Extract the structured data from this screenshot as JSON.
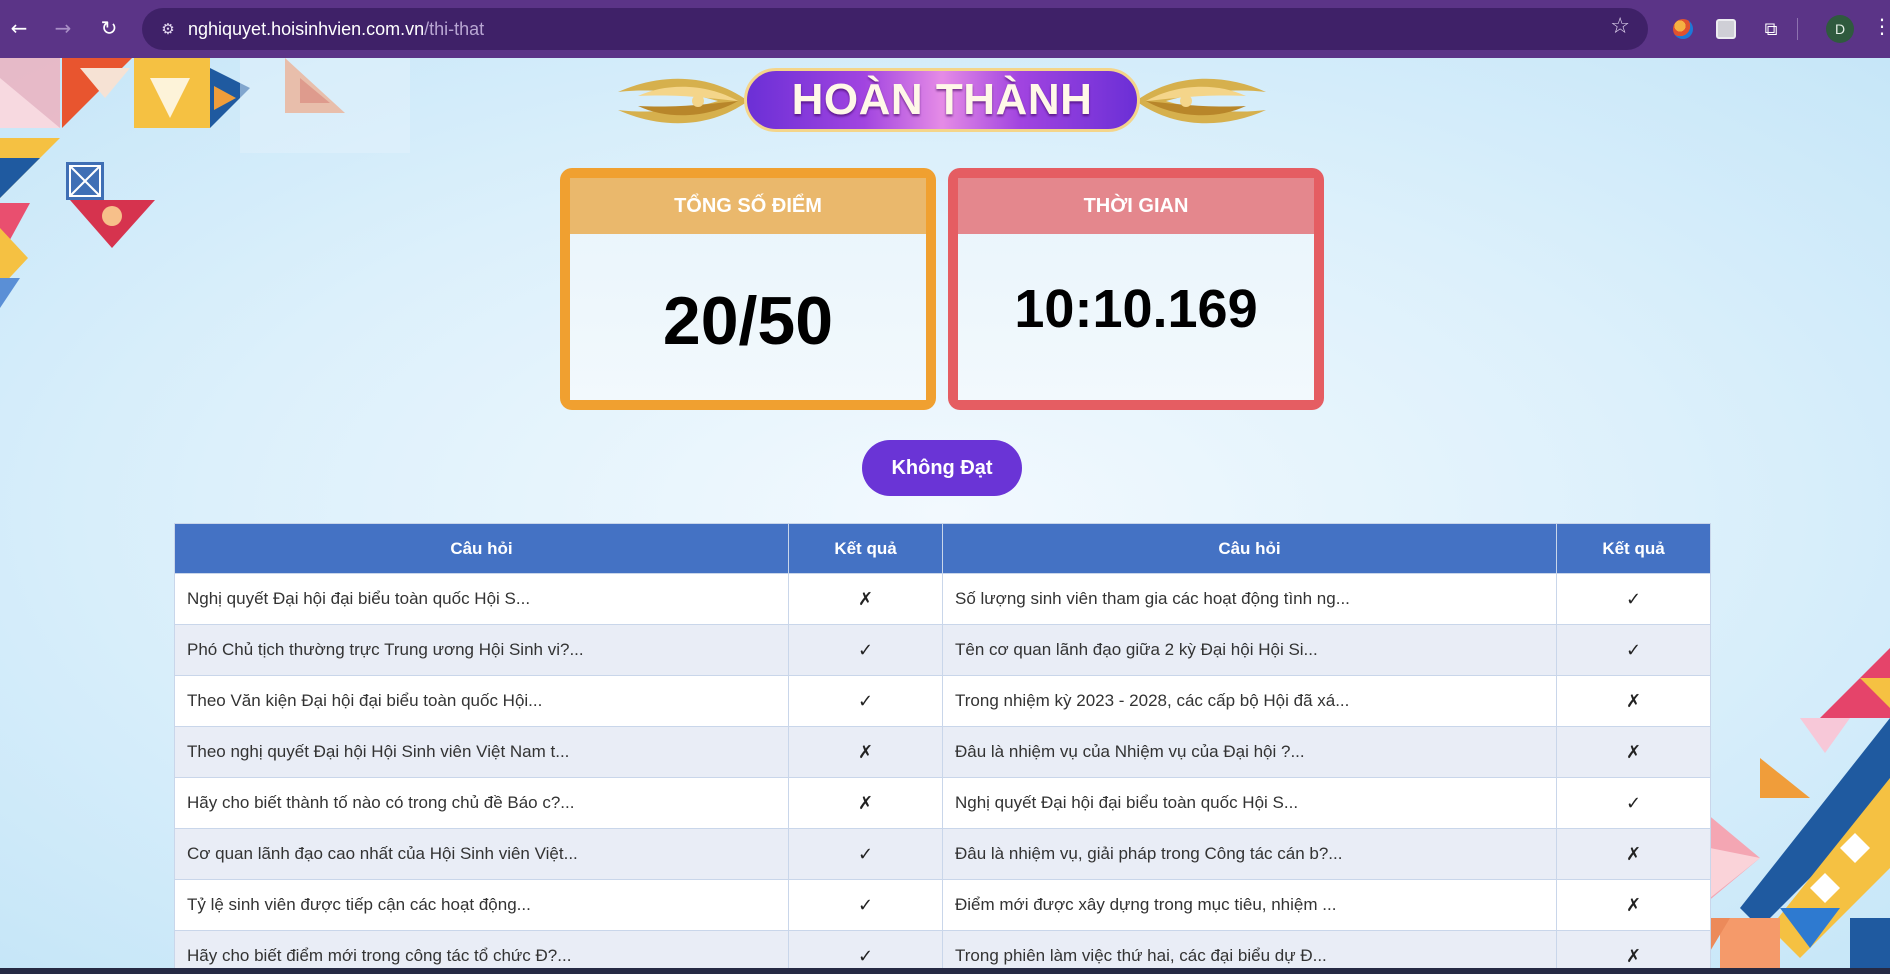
{
  "browser": {
    "url_host": "nghiquyet.hoisinhvien.com.vn",
    "url_path": "/thi-that",
    "profile_initial": "D",
    "icons": [
      "back-icon",
      "forward-icon",
      "reload-icon",
      "site-info-icon",
      "bookmark-star-icon",
      "firefox-extension-icon",
      "extension-icon",
      "puzzle-extensions-icon",
      "menu-icon"
    ]
  },
  "banner": {
    "title": "HOÀN THÀNH"
  },
  "score_card": {
    "label": "TỔNG SỐ ĐIỂM",
    "value": "20/50"
  },
  "time_card": {
    "label": "THỜI GIAN",
    "value": "10:10.169"
  },
  "status": {
    "label": "Không Đạt"
  },
  "colors": {
    "chrome": "#5b3487",
    "score_card": "#f0a030",
    "time_card": "#e55d62",
    "status_button": "#6a34d6",
    "table_header": "#4472c4"
  },
  "table": {
    "headers": [
      "Câu hỏi",
      "Kết quả",
      "Câu hỏi",
      "Kết quả"
    ],
    "rows": [
      {
        "q1": "Nghị quyết Đại hội đại biểu toàn quốc Hội S...",
        "r1": "✗",
        "q2": "Số lượng sinh viên tham gia các hoạt động tình ng...",
        "r2": "✓"
      },
      {
        "q1": "Phó Chủ tịch thường trực Trung ương Hội Sinh vi?...",
        "r1": "✓",
        "q2": "Tên cơ quan lãnh đạo giữa 2 kỳ Đại hội Hội Si...",
        "r2": "✓"
      },
      {
        "q1": "Theo Văn kiện Đại hội đại biểu toàn quốc Hội...",
        "r1": "✓",
        "q2": "Trong nhiệm kỳ 2023 - 2028, các cấp bộ Hội đã xá...",
        "r2": "✗"
      },
      {
        "q1": "Theo nghị quyết Đại hội Hội Sinh viên Việt Nam t...",
        "r1": "✗",
        "q2": "Đâu là nhiệm vụ của Nhiệm vụ của Đại hội ?...",
        "r2": "✗"
      },
      {
        "q1": "Hãy cho biết thành tố nào có trong chủ đề Báo c?...",
        "r1": "✗",
        "q2": "Nghị quyết Đại hội đại biểu toàn quốc Hội S...",
        "r2": "✓"
      },
      {
        "q1": "Cơ quan lãnh đạo cao nhất của Hội Sinh viên Việt...",
        "r1": "✓",
        "q2": "Đâu là nhiệm vụ, giải pháp trong Công tác cán b?...",
        "r2": "✗"
      },
      {
        "q1": "Tỷ lệ sinh viên được tiếp cận các hoạt động...",
        "r1": "✓",
        "q2": "Điểm mới được xây dựng trong mục tiêu, nhiệm ...",
        "r2": "✗"
      },
      {
        "q1": "Hãy cho biết điểm mới trong công tác tổ chức Đ?...",
        "r1": "✓",
        "q2": "Trong phiên làm việc thứ hai, các đại biểu dự Đ...",
        "r2": "✗"
      }
    ]
  }
}
